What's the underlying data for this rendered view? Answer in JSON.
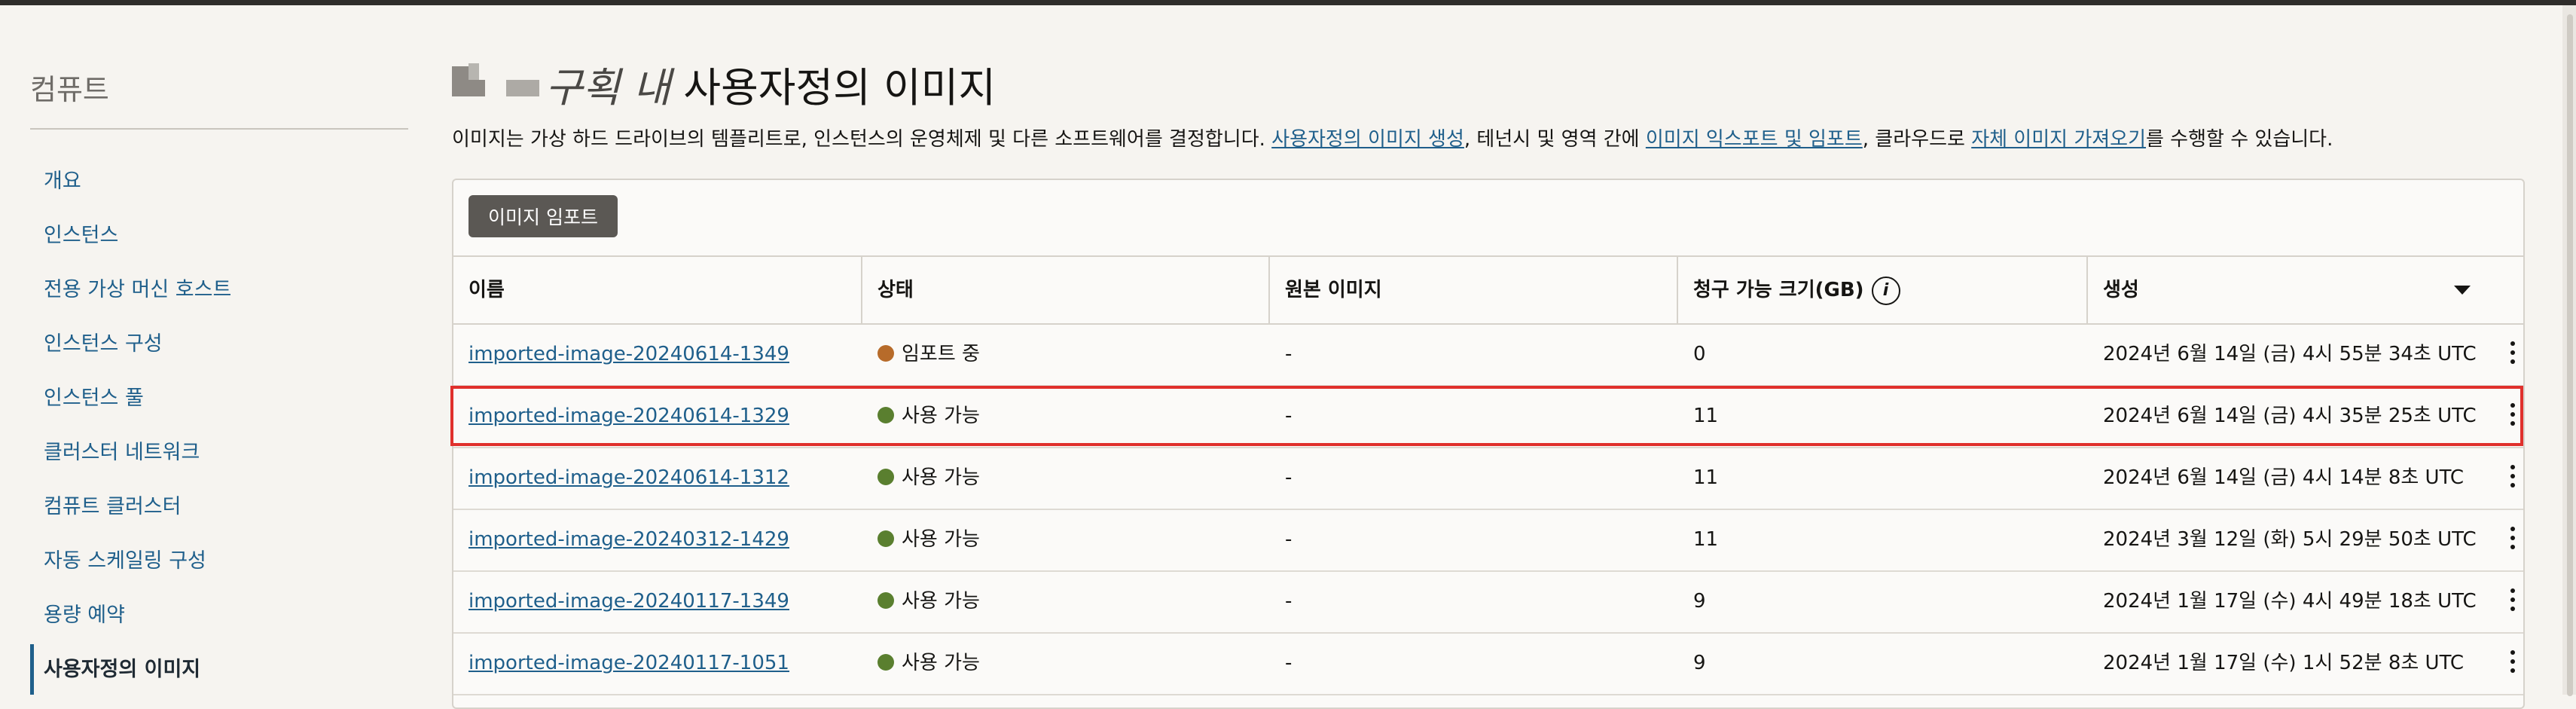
{
  "sidebar": {
    "title": "컴퓨트",
    "items": [
      {
        "label": "개요",
        "active": false
      },
      {
        "label": "인스턴스",
        "active": false
      },
      {
        "label": "전용 가상 머신 호스트",
        "active": false
      },
      {
        "label": "인스턴스 구성",
        "active": false
      },
      {
        "label": "인스턴스 풀",
        "active": false
      },
      {
        "label": "클러스터 네트워크",
        "active": false
      },
      {
        "label": "컴퓨트 클러스터",
        "active": false
      },
      {
        "label": "자동 스케일링 구성",
        "active": false
      },
      {
        "label": "용량 예약",
        "active": false
      },
      {
        "label": "사용자정의 이미지",
        "active": true
      }
    ]
  },
  "header": {
    "title_italic": "구획 내",
    "title": "사용자정의 이미지",
    "description": {
      "part1": "이미지는 가상 하드 드라이브의 템플리트로, 인스턴스의 운영체제 및 다른 소프트웨어를 결정합니다. ",
      "link1": "사용자정의 이미지 생성",
      "part2": ", 테넌시 및 영역 간에 ",
      "link2": "이미지 익스포트 및 임포트",
      "part3": ", 클라우드로 ",
      "link3": "자체 이미지 가져오기",
      "part4": "를 수행할 수 있습니다."
    }
  },
  "toolbar": {
    "import_label": "이미지 임포트"
  },
  "table": {
    "columns": {
      "name": "이름",
      "state": "상태",
      "source": "원본 이미지",
      "size": "청구 가능 크기(GB)",
      "created": "생성"
    },
    "status_colors": {
      "importing": "#b76b2a",
      "available": "#5a7f2f"
    },
    "rows": [
      {
        "name": "imported-image-20240614-1349",
        "state": "임포트 중",
        "state_kind": "importing",
        "source": "-",
        "size": "0",
        "created": "2024년 6월 14일 (금) 4시 55분 34초 UTC"
      },
      {
        "name": "imported-image-20240614-1329",
        "state": "사용 가능",
        "state_kind": "available",
        "source": "-",
        "size": "11",
        "created": "2024년 6월 14일 (금) 4시 35분 25초 UTC",
        "highlighted": true
      },
      {
        "name": "imported-image-20240614-1312",
        "state": "사용 가능",
        "state_kind": "available",
        "source": "-",
        "size": "11",
        "created": "2024년 6월 14일 (금) 4시 14분 8초 UTC"
      },
      {
        "name": "imported-image-20240312-1429",
        "state": "사용 가능",
        "state_kind": "available",
        "source": "-",
        "size": "11",
        "created": "2024년 3월 12일 (화) 5시 29분 50초 UTC"
      },
      {
        "name": "imported-image-20240117-1349",
        "state": "사용 가능",
        "state_kind": "available",
        "source": "-",
        "size": "9",
        "created": "2024년 1월 17일 (수) 4시 49분 18초 UTC"
      },
      {
        "name": "imported-image-20240117-1051",
        "state": "사용 가능",
        "state_kind": "available",
        "source": "-",
        "size": "9",
        "created": "2024년 1월 17일 (수) 1시 52분 8초 UTC"
      }
    ]
  }
}
